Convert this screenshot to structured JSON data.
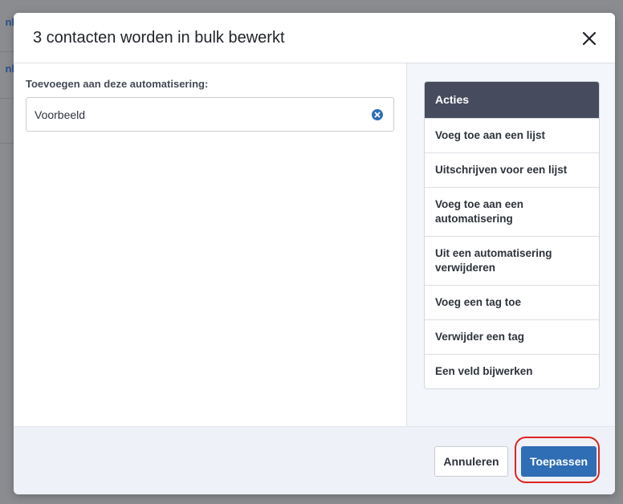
{
  "background": {
    "peek_text_1": "nl",
    "peek_text_2": "nl"
  },
  "modal": {
    "title": "3 contacten worden in bulk bewerkt",
    "close_icon": "close-icon"
  },
  "left": {
    "field_label": "Toevoegen aan deze automatisering:",
    "field_value": "Voorbeeld",
    "clear_icon": "clear-circle-icon"
  },
  "actions": {
    "header": "Acties",
    "items": [
      {
        "label": "Voeg toe aan een lijst"
      },
      {
        "label": "Uitschrijven voor een lijst"
      },
      {
        "label": "Voeg toe aan een automatisering"
      },
      {
        "label": "Uit een automatisering verwijderen"
      },
      {
        "label": "Voeg een tag toe"
      },
      {
        "label": "Verwijder een tag"
      },
      {
        "label": "Een veld bijwerken"
      }
    ]
  },
  "footer": {
    "cancel_label": "Annuleren",
    "apply_label": "Toepassen"
  },
  "colors": {
    "primary": "#2f6db5",
    "actions_header_bg": "#464c5e",
    "highlight": "#e0231f",
    "clear_icon": "#2f6db5"
  }
}
